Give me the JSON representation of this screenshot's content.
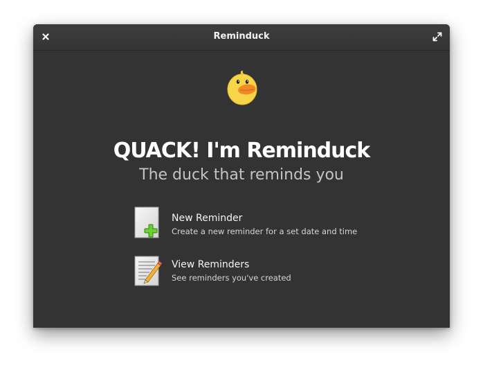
{
  "window": {
    "title": "Reminduck"
  },
  "titlebar": {
    "close_icon": "close-icon",
    "maximize_icon": "maximize-icon"
  },
  "welcome": {
    "logo_icon": "duck-logo-icon",
    "heading": "QUACK! I'm Reminduck",
    "subheading": "The duck that reminds you"
  },
  "actions": [
    {
      "icon": "new-document-plus-icon",
      "title": "New Reminder",
      "description": "Create a new reminder for a set date and time"
    },
    {
      "icon": "document-edit-icon",
      "title": "View Reminders",
      "description": "See reminders you've created"
    }
  ],
  "colors": {
    "window_bg": "#333333",
    "titlebar_bg": "#3a3a3a",
    "text_primary": "#ffffff",
    "text_secondary": "#c4c4c4",
    "plus_green": "#5fbf2c",
    "duck_yellow": "#f7d548",
    "duck_beak": "#f08a24"
  }
}
